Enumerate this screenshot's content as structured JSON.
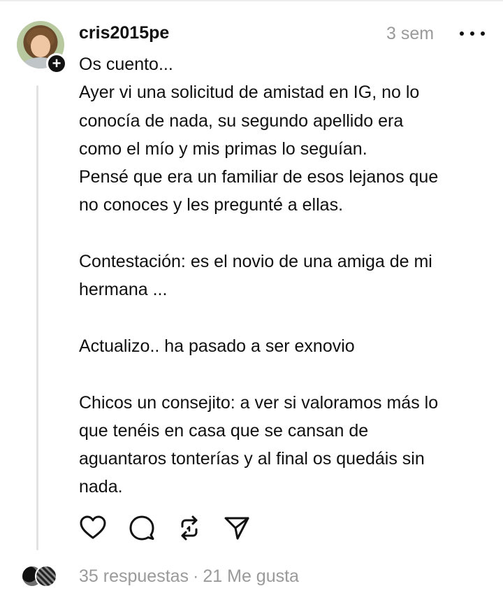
{
  "post": {
    "username": "cris2015pe",
    "timestamp": "3 sem",
    "body": "Os cuento...\nAyer vi una solicitud de amistad en IG, no lo\nconocía de nada, su segundo apellido era\ncomo el mío y mis primas lo seguían.\nPensé que era un familiar de esos lejanos que\nno conoces y les pregunté a ellas.\n\nContestación: es el novio de una amiga de mi\nhermana ...\n\nActualizo.. ha pasado a ser exnovio\n\nChicos un consejito: a ver si valoramos más lo\nque tenéis en casa que se cansan de\naguantaros tonterías y al final os quedáis sin\nnada.",
    "follow_badge": "+"
  },
  "icons": {
    "more": "more-horizontal-icon",
    "like": "heart-icon",
    "reply": "comment-icon",
    "repost": "repost-icon",
    "share": "send-icon"
  },
  "stats": {
    "replies": "35 respuestas",
    "separator": "·",
    "likes": "21 Me gusta"
  },
  "colors": {
    "text": "#101010",
    "muted": "#9a9a9a",
    "thread_line": "#e2e2e2"
  }
}
